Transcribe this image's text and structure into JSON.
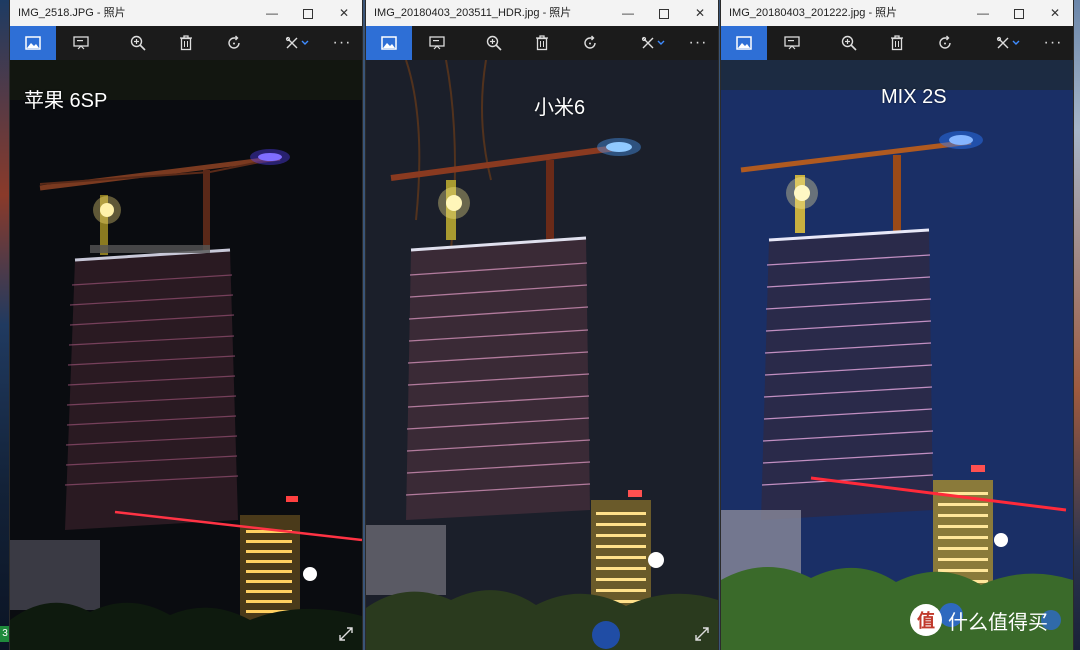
{
  "windows": [
    {
      "title": "IMG_2518.JPG - 照片",
      "caption": "苹果 6SP",
      "sky": "#0b0d12"
    },
    {
      "title": "IMG_20180403_203511_HDR.jpg - 照片",
      "caption": "小米6",
      "sky": "#1b1f2a"
    },
    {
      "title": "IMG_20180403_201222.jpg - 照片",
      "caption": "MIX 2S",
      "sky": "#1a2f66"
    }
  ],
  "window_controls": {
    "minimize": "—",
    "close": "✕"
  },
  "toolbar": {
    "more": "···"
  },
  "taskbar": {
    "chip": "3"
  },
  "watermark": {
    "badge": "值",
    "text": "什么值得买"
  },
  "colors": {
    "accent": "#2e6fd6",
    "titlebar": "#f3f3f3",
    "toolbar": "#1b1b1b"
  }
}
